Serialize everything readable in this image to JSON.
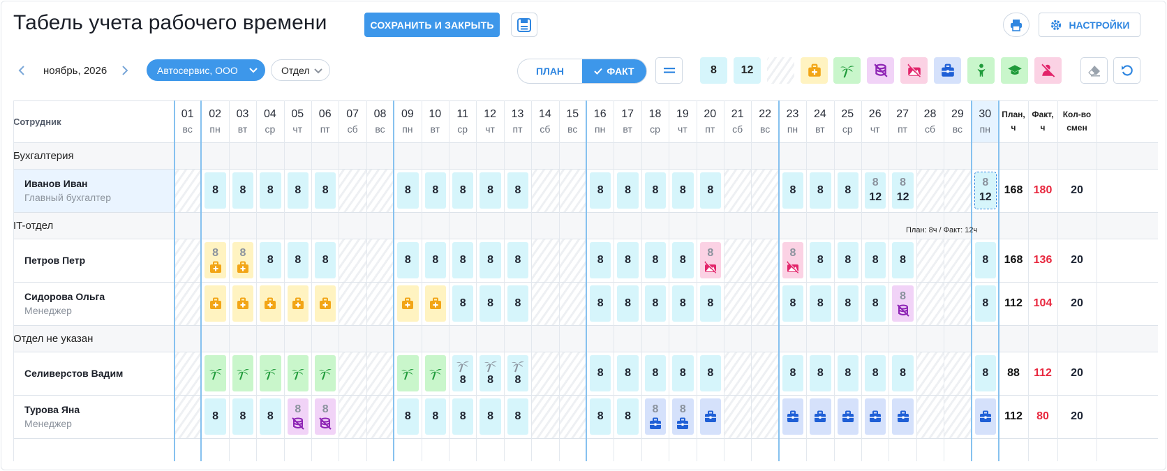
{
  "header": {
    "title": "Табель учета рабочего времени",
    "save_close_label": "СОХРАНИТЬ И ЗАКРЫТЬ",
    "settings_label": "НАСТРОЙКИ"
  },
  "toolbar": {
    "month": "ноябрь, 2026",
    "organization": "Автосервис, ООО",
    "department": "Отдел",
    "mode_plan": "ПЛАН",
    "mode_fact": "ФАКТ",
    "mode_selected": "fact",
    "value_tools": [
      "8",
      "12"
    ],
    "status_tools": [
      "sick",
      "vacation",
      "unpaid",
      "absent",
      "trip",
      "maternity",
      "study",
      "dismissed"
    ]
  },
  "colors": {
    "accent": "#3d97ea",
    "work": "#d6f5fb",
    "sick": "#fff3c1",
    "vacation": "#c9f6cb",
    "unpaid": "#f1d3f7",
    "absent": "#fbd2e4",
    "trip": "#d5e1fb",
    "fact_text": "#e8283f"
  },
  "table": {
    "employee_header": "Сотрудник",
    "plan_header": "План, ч",
    "fact_header": "Факт, ч",
    "count_header": "Кол-во смен",
    "days": [
      {
        "n": "01",
        "wd": "вс"
      },
      {
        "n": "02",
        "wd": "пн"
      },
      {
        "n": "03",
        "wd": "вт"
      },
      {
        "n": "04",
        "wd": "ср"
      },
      {
        "n": "05",
        "wd": "чт"
      },
      {
        "n": "06",
        "wd": "пт"
      },
      {
        "n": "07",
        "wd": "сб"
      },
      {
        "n": "08",
        "wd": "вс"
      },
      {
        "n": "09",
        "wd": "пн"
      },
      {
        "n": "10",
        "wd": "вт"
      },
      {
        "n": "11",
        "wd": "ср"
      },
      {
        "n": "12",
        "wd": "чт"
      },
      {
        "n": "13",
        "wd": "пт"
      },
      {
        "n": "14",
        "wd": "сб"
      },
      {
        "n": "15",
        "wd": "вс"
      },
      {
        "n": "16",
        "wd": "пн"
      },
      {
        "n": "17",
        "wd": "вт"
      },
      {
        "n": "18",
        "wd": "ср"
      },
      {
        "n": "19",
        "wd": "чт"
      },
      {
        "n": "20",
        "wd": "пт"
      },
      {
        "n": "21",
        "wd": "сб"
      },
      {
        "n": "22",
        "wd": "вс"
      },
      {
        "n": "23",
        "wd": "пн"
      },
      {
        "n": "24",
        "wd": "вт"
      },
      {
        "n": "25",
        "wd": "ср"
      },
      {
        "n": "26",
        "wd": "чт"
      },
      {
        "n": "27",
        "wd": "пт"
      },
      {
        "n": "28",
        "wd": "сб"
      },
      {
        "n": "29",
        "wd": "вс"
      },
      {
        "n": "30",
        "wd": "пн"
      }
    ],
    "groups": [
      {
        "name": "Бухгалтерия",
        "employees": [
          {
            "name": "Иванов Иван",
            "position": "Главный бухгалтер",
            "plan": "168",
            "fact": "180",
            "count": "20",
            "cells": [
              "off",
              "8",
              "8",
              "8",
              "8",
              "8",
              "off",
              "off",
              "8",
              "8",
              "8",
              "8",
              "8",
              "off",
              "off",
              "8",
              "8",
              "8",
              "8",
              "8",
              "off",
              "off",
              "8",
              "8",
              "8",
              "8/12",
              "8/12",
              "off",
              "off",
              "8/12"
            ]
          }
        ]
      },
      {
        "name": "IT-отдел",
        "employees": [
          {
            "name": "Петров Петр",
            "position": "",
            "plan": "168",
            "fact": "136",
            "count": "20",
            "cells": [
              "off",
              "8/sick",
              "8/sick",
              "8",
              "8",
              "8",
              "off",
              "off",
              "8",
              "8",
              "8",
              "8",
              "8",
              "off",
              "off",
              "8",
              "8",
              "8",
              "8",
              "8/absent",
              "off",
              "off",
              "8/absent",
              "8",
              "8",
              "8",
              "8",
              "off",
              "off",
              "8"
            ]
          },
          {
            "name": "Сидорова Ольга",
            "position": "Менеджер",
            "plan": "112",
            "fact": "104",
            "count": "20",
            "cells": [
              "off",
              "sick",
              "sick",
              "sick",
              "sick",
              "sick",
              "off",
              "off",
              "sick",
              "sick",
              "8",
              "8",
              "8",
              "off",
              "off",
              "8",
              "8",
              "8",
              "8",
              "8",
              "off",
              "off",
              "8",
              "8",
              "8",
              "8",
              "8/unpaid",
              "off",
              "off",
              "8"
            ]
          }
        ]
      },
      {
        "name": "Отдел не указан",
        "employees": [
          {
            "name": "Селиверстов Вадим",
            "position": "",
            "plan": "88",
            "fact": "112",
            "count": "20",
            "cells": [
              "off",
              "vac",
              "vac",
              "vac",
              "vac",
              "vac",
              "off",
              "off",
              "vac",
              "vac",
              "vac/8",
              "vac/8",
              "vac/8",
              "off",
              "off",
              "8",
              "8",
              "8",
              "8",
              "8",
              "off",
              "off",
              "8",
              "8",
              "8",
              "8",
              "8",
              "off",
              "off",
              "8"
            ]
          },
          {
            "name": "Турова Яна",
            "position": "Менеджер",
            "plan": "112",
            "fact": "80",
            "count": "20",
            "cells": [
              "off",
              "8",
              "8",
              "8",
              "8/unpaid",
              "8/unpaid",
              "off",
              "off",
              "8",
              "8",
              "8",
              "8",
              "8",
              "off",
              "off",
              "8",
              "8",
              "8/trip",
              "8/trip",
              "trip",
              "off",
              "off",
              "trip",
              "trip",
              "trip",
              "trip",
              "trip",
              "off",
              "off",
              "trip"
            ]
          }
        ]
      }
    ],
    "tooltip": "План: 8ч / Факт: 12ч"
  }
}
